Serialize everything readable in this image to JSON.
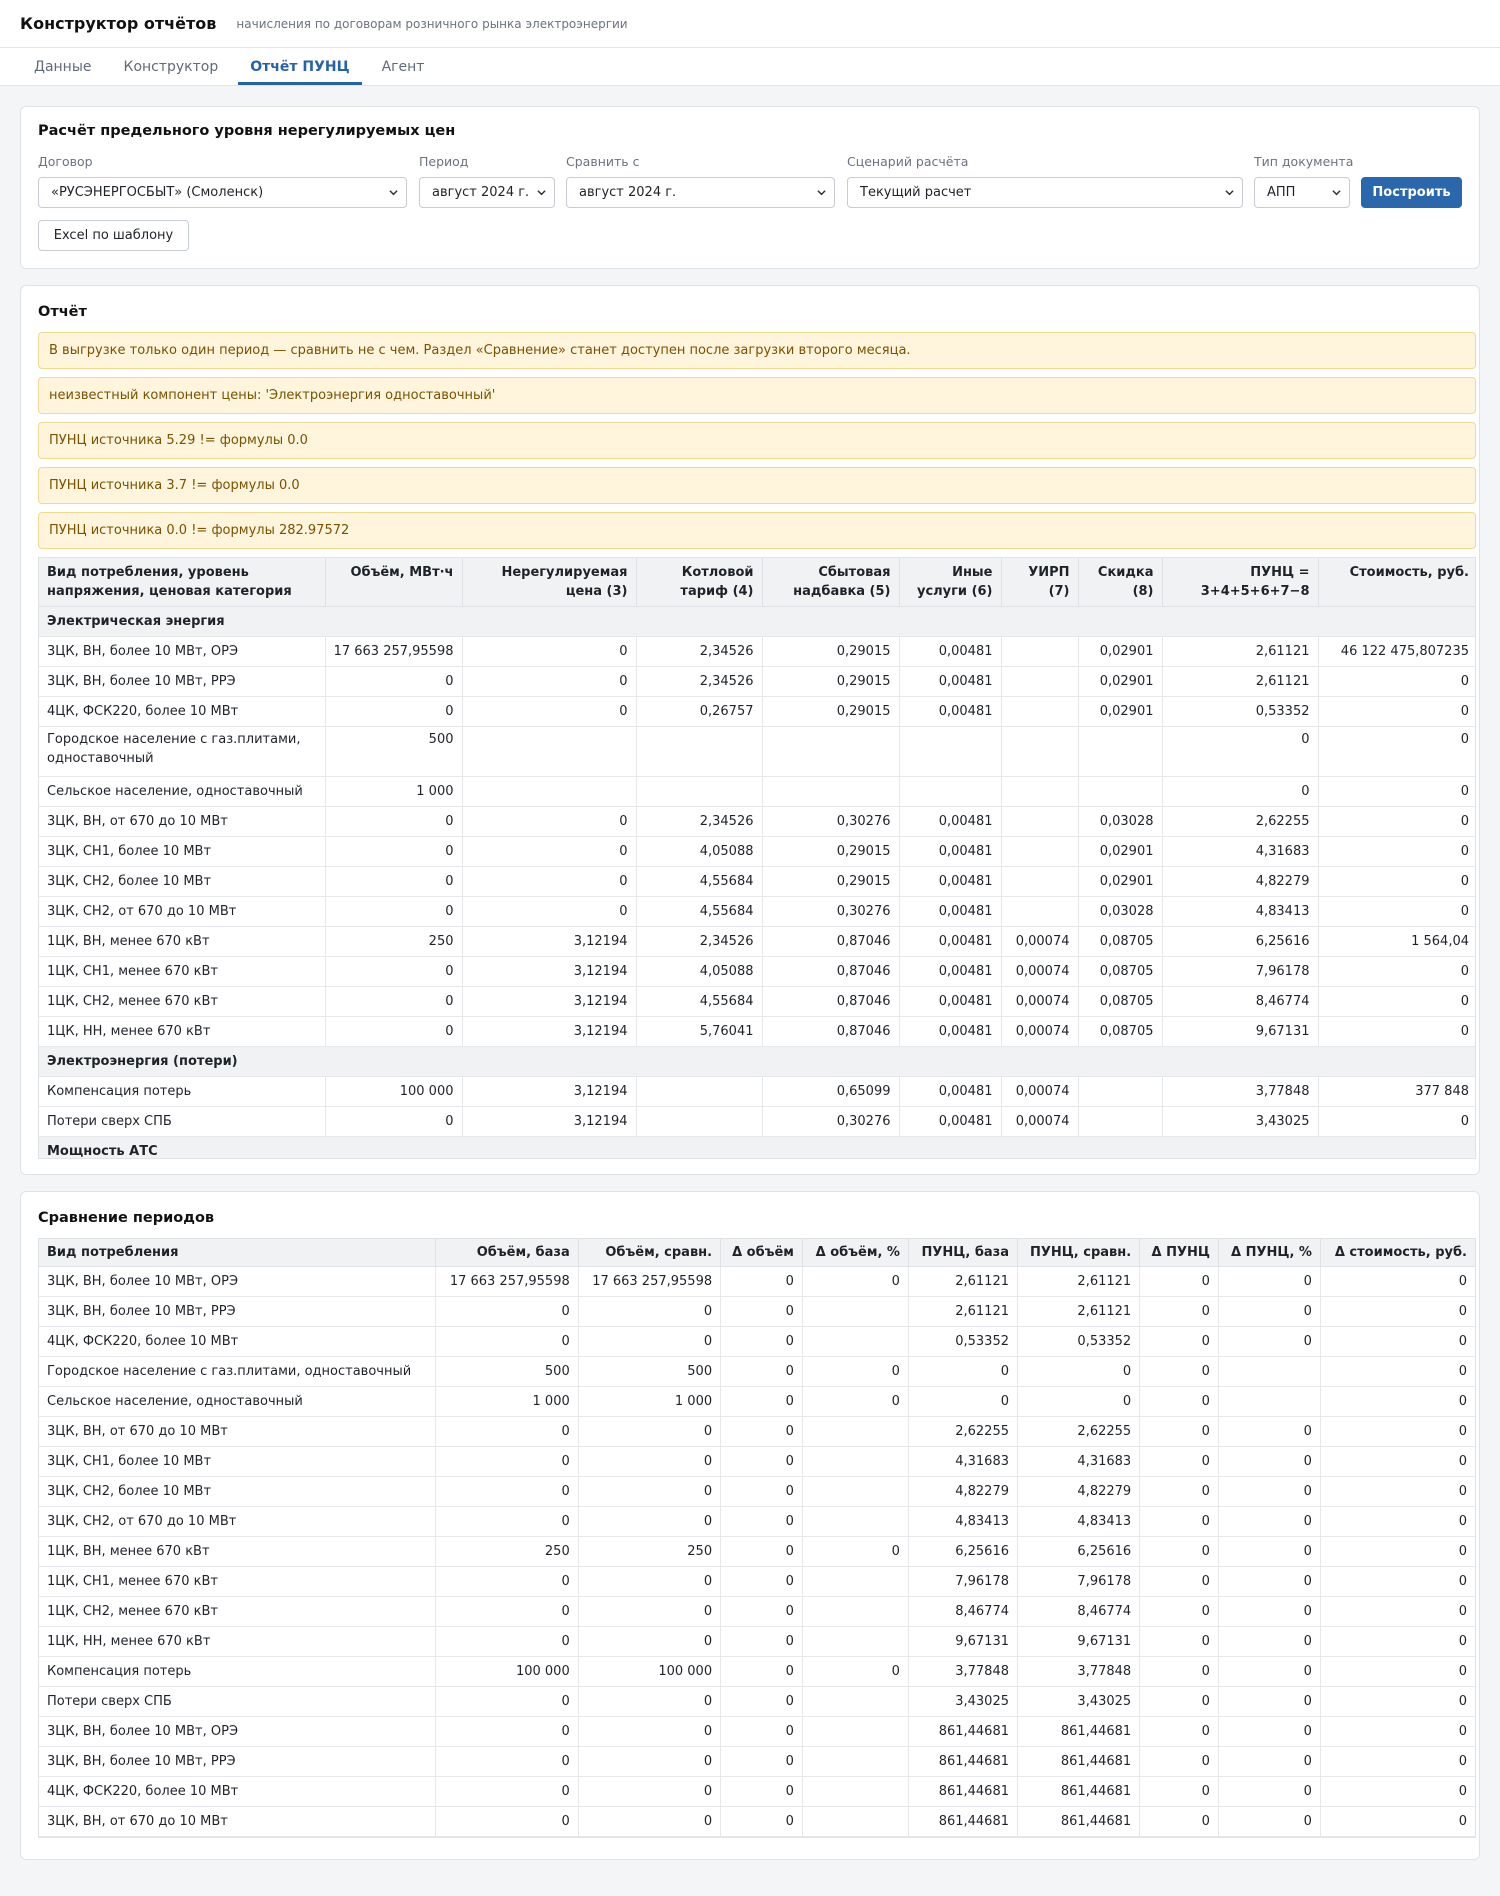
{
  "app": {
    "title": "Конструктор отчётов",
    "subtitle": "начисления по договорам розничного рынка электроэнергии"
  },
  "tabs": [
    {
      "label": "Данные",
      "active": false
    },
    {
      "label": "Конструктор",
      "active": false
    },
    {
      "label": "Отчёт ПУНЦ",
      "active": true
    },
    {
      "label": "Агент",
      "active": false
    }
  ],
  "filter": {
    "title": "Расчёт предельного уровня нерегулируемых цен",
    "contract_label": "Договор",
    "contract_value": "«РУСЭНЕРГОСБЫТ» (Смоленск)",
    "period_label": "Период",
    "period_value": "август 2024 г.",
    "compare_label": "Сравнить с",
    "compare_value": "август 2024 г.",
    "scenario_label": "Сценарий расчёта",
    "scenario_value": "Текущий расчет",
    "doctype_label": "Тип документа",
    "doctype_value": "АПП",
    "build_button": "Построить",
    "excel_button": "Excel по шаблону"
  },
  "report": {
    "title": "Отчёт",
    "alerts": [
      "В выгрузке только один период — сравнить не с чем. Раздел «Сравнение» станет доступен после загрузки второго месяца.",
      "неизвестный компонент цены: 'Электроэнергия одноставочный'",
      "ПУНЦ источника 5.29 != формулы 0.0",
      "ПУНЦ источника 3.7 != формулы 0.0",
      "ПУНЦ источника 0.0 != формулы 282.97572"
    ],
    "columns": [
      "Вид потребления, уровень напряжения, ценовая категория",
      "Объём, МВт·ч",
      "Нерегулируемая цена (3)",
      "Котловой тариф (4)",
      "Сбытовая надбавка (5)",
      "Иные услуги (6)",
      "УИРП (7)",
      "Скидка (8)",
      "ПУНЦ = 3+4+5+6+7−8",
      "Стоимость, руб."
    ],
    "sections": [
      {
        "name": "Электрическая энергия",
        "rows": [
          [
            "3ЦК, ВН, более 10 МВт, ОРЭ",
            "17 663 257,95598",
            "0",
            "2,34526",
            "0,29015",
            "0,00481",
            "",
            "0,02901",
            "2,61121",
            "46 122 475,807235"
          ],
          [
            "3ЦК, ВН, более 10 МВт, РРЭ",
            "0",
            "0",
            "2,34526",
            "0,29015",
            "0,00481",
            "",
            "0,02901",
            "2,61121",
            "0"
          ],
          [
            "4ЦК, ФСК220, более 10 МВт",
            "0",
            "0",
            "0,26757",
            "0,29015",
            "0,00481",
            "",
            "0,02901",
            "0,53352",
            "0"
          ],
          [
            "Городское население с газ.плитами, одноставочный",
            "500",
            "",
            "",
            "",
            "",
            "",
            "",
            "0",
            "0"
          ],
          [
            "Сельское население, одноставочный",
            "1 000",
            "",
            "",
            "",
            "",
            "",
            "",
            "0",
            "0"
          ],
          [
            "3ЦК, ВН, от 670 до 10 МВт",
            "0",
            "0",
            "2,34526",
            "0,30276",
            "0,00481",
            "",
            "0,03028",
            "2,62255",
            "0"
          ],
          [
            "3ЦК, СН1, более 10 МВт",
            "0",
            "0",
            "4,05088",
            "0,29015",
            "0,00481",
            "",
            "0,02901",
            "4,31683",
            "0"
          ],
          [
            "3ЦК, СН2, более 10 МВт",
            "0",
            "0",
            "4,55684",
            "0,29015",
            "0,00481",
            "",
            "0,02901",
            "4,82279",
            "0"
          ],
          [
            "3ЦК, СН2, от 670 до 10 МВт",
            "0",
            "0",
            "4,55684",
            "0,30276",
            "0,00481",
            "",
            "0,03028",
            "4,83413",
            "0"
          ],
          [
            "1ЦК, ВН, менее 670 кВт",
            "250",
            "3,12194",
            "2,34526",
            "0,87046",
            "0,00481",
            "0,00074",
            "0,08705",
            "6,25616",
            "1 564,04"
          ],
          [
            "1ЦК, СН1, менее 670 кВт",
            "0",
            "3,12194",
            "4,05088",
            "0,87046",
            "0,00481",
            "0,00074",
            "0,08705",
            "7,96178",
            "0"
          ],
          [
            "1ЦК, СН2, менее 670 кВт",
            "0",
            "3,12194",
            "4,55684",
            "0,87046",
            "0,00481",
            "0,00074",
            "0,08705",
            "8,46774",
            "0"
          ],
          [
            "1ЦК, НН, менее 670 кВт",
            "0",
            "3,12194",
            "5,76041",
            "0,87046",
            "0,00481",
            "0,00074",
            "0,08705",
            "9,67131",
            "0"
          ]
        ]
      },
      {
        "name": "Электроэнергия (потери)",
        "rows": [
          [
            "Компенсация потерь",
            "100 000",
            "3,12194",
            "",
            "0,65099",
            "0,00481",
            "0,00074",
            "",
            "3,77848",
            "377 848"
          ],
          [
            "Потери сверх СПБ",
            "0",
            "3,12194",
            "",
            "0,30276",
            "0,00481",
            "0,00074",
            "",
            "3,43025",
            "0"
          ]
        ]
      },
      {
        "name": "Мощность АТС",
        "rows": []
      }
    ]
  },
  "compare": {
    "title": "Сравнение периодов",
    "columns": [
      "Вид потребления",
      "Объём, база",
      "Объём, сравн.",
      "Δ объём",
      "Δ объём, %",
      "ПУНЦ, база",
      "ПУНЦ, сравн.",
      "Δ ПУНЦ",
      "Δ ПУНЦ, %",
      "Δ стоимость, руб."
    ],
    "rows": [
      [
        "3ЦК, ВН, более 10 МВт, ОРЭ",
        "17 663 257,95598",
        "17 663 257,95598",
        "0",
        "0",
        "2,61121",
        "2,61121",
        "0",
        "0",
        "0"
      ],
      [
        "3ЦК, ВН, более 10 МВт, РРЭ",
        "0",
        "0",
        "0",
        "",
        "2,61121",
        "2,61121",
        "0",
        "0",
        "0"
      ],
      [
        "4ЦК, ФСК220, более 10 МВт",
        "0",
        "0",
        "0",
        "",
        "0,53352",
        "0,53352",
        "0",
        "0",
        "0"
      ],
      [
        "Городское население с газ.плитами, одноставочный",
        "500",
        "500",
        "0",
        "0",
        "0",
        "0",
        "0",
        "",
        "0"
      ],
      [
        "Сельское население, одноставочный",
        "1 000",
        "1 000",
        "0",
        "0",
        "0",
        "0",
        "0",
        "",
        "0"
      ],
      [
        "3ЦК, ВН, от 670 до 10 МВт",
        "0",
        "0",
        "0",
        "",
        "2,62255",
        "2,62255",
        "0",
        "0",
        "0"
      ],
      [
        "3ЦК, СН1, более 10 МВт",
        "0",
        "0",
        "0",
        "",
        "4,31683",
        "4,31683",
        "0",
        "0",
        "0"
      ],
      [
        "3ЦК, СН2, более 10 МВт",
        "0",
        "0",
        "0",
        "",
        "4,82279",
        "4,82279",
        "0",
        "0",
        "0"
      ],
      [
        "3ЦК, СН2, от 670 до 10 МВт",
        "0",
        "0",
        "0",
        "",
        "4,83413",
        "4,83413",
        "0",
        "0",
        "0"
      ],
      [
        "1ЦК, ВН, менее 670 кВт",
        "250",
        "250",
        "0",
        "0",
        "6,25616",
        "6,25616",
        "0",
        "0",
        "0"
      ],
      [
        "1ЦК, СН1, менее 670 кВт",
        "0",
        "0",
        "0",
        "",
        "7,96178",
        "7,96178",
        "0",
        "0",
        "0"
      ],
      [
        "1ЦК, СН2, менее 670 кВт",
        "0",
        "0",
        "0",
        "",
        "8,46774",
        "8,46774",
        "0",
        "0",
        "0"
      ],
      [
        "1ЦК, НН, менее 670 кВт",
        "0",
        "0",
        "0",
        "",
        "9,67131",
        "9,67131",
        "0",
        "0",
        "0"
      ],
      [
        "Компенсация потерь",
        "100 000",
        "100 000",
        "0",
        "0",
        "3,77848",
        "3,77848",
        "0",
        "0",
        "0"
      ],
      [
        "Потери сверх СПБ",
        "0",
        "0",
        "0",
        "",
        "3,43025",
        "3,43025",
        "0",
        "0",
        "0"
      ],
      [
        "3ЦК, ВН, более 10 МВт, ОРЭ",
        "0",
        "0",
        "0",
        "",
        "861,44681",
        "861,44681",
        "0",
        "0",
        "0"
      ],
      [
        "3ЦК, ВН, более 10 МВт, РРЭ",
        "0",
        "0",
        "0",
        "",
        "861,44681",
        "861,44681",
        "0",
        "0",
        "0"
      ],
      [
        "4ЦК, ФСК220, более 10 МВт",
        "0",
        "0",
        "0",
        "",
        "861,44681",
        "861,44681",
        "0",
        "0",
        "0"
      ],
      [
        "3ЦК, ВН, от 670 до 10 МВт",
        "0",
        "0",
        "0",
        "",
        "861,44681",
        "861,44681",
        "0",
        "0",
        "0"
      ]
    ]
  },
  "colors": {
    "accent": "#2b67ad",
    "alert_bg": "#fef5dc",
    "alert_text": "#7a5200"
  }
}
